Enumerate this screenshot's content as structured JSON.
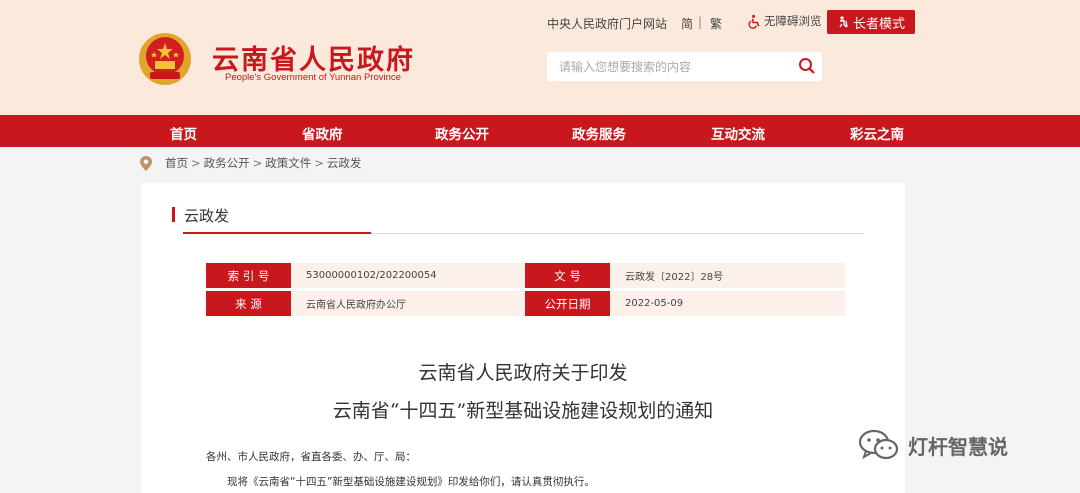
{
  "header": {
    "site_title": "云南省人民政府",
    "site_subtitle": "People's Government of Yunnan Province",
    "top_links": {
      "central_portal": "中央人民政府门户网站",
      "simplified": "简",
      "divider": "|",
      "traditional": "繁"
    },
    "accessibility_label": "无障碍浏览",
    "elder_mode_label": "长者模式",
    "search_placeholder": "请输入您想要搜索的内容"
  },
  "nav": {
    "items": [
      "首页",
      "省政府",
      "政务公开",
      "政务服务",
      "互动交流",
      "彩云之南"
    ]
  },
  "breadcrumb": [
    "首页",
    "政务公开",
    "政策文件",
    "云政发"
  ],
  "breadcrumb_sep": ">",
  "section": {
    "title": "云政发"
  },
  "meta": {
    "index_label": "索 引 号",
    "index_value": "53000000102/202200054",
    "doc_no_label": "文 号",
    "doc_no_value": "云政发〔2022〕28号",
    "source_label": "来 源",
    "source_value": "云南省人民政府办公厅",
    "date_label": "公开日期",
    "date_value": "2022-05-09"
  },
  "document": {
    "title_line1": "云南省人民政府关于印发",
    "title_line2": "云南省“十四五”新型基础设施建设规划的通知",
    "salutation": "各州、市人民政府，省直各委、办、厅、局：",
    "paragraph1": "现将《云南省“十四五”新型基础设施建设规划》印发给你们，请认真贯彻执行。"
  },
  "watermark": {
    "text": "灯杆智慧说"
  },
  "colors": {
    "brand_red": "#c9171e",
    "header_bg": "#fbeadb",
    "meta_bg": "#fbf1ea"
  }
}
